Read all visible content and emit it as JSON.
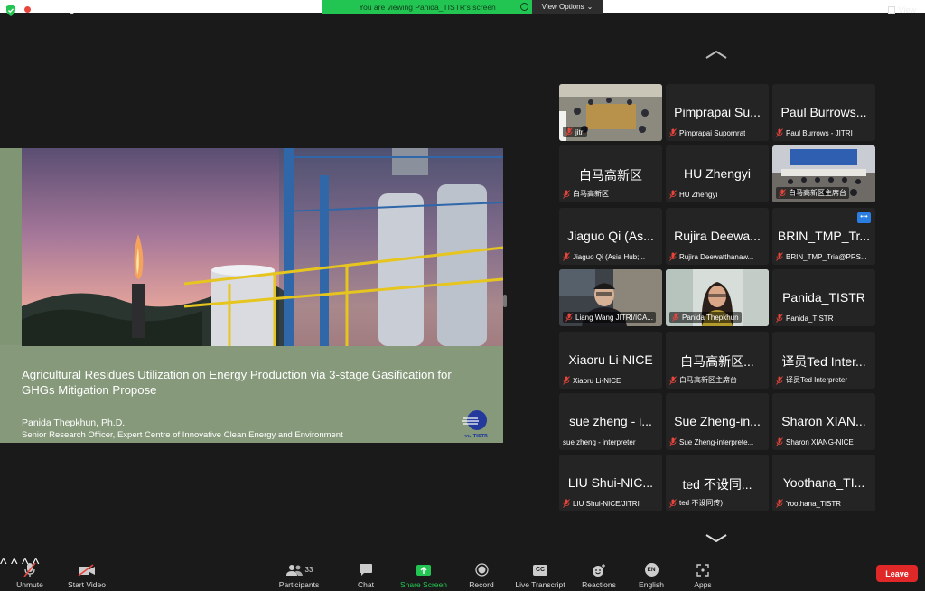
{
  "status": {
    "recording_label": "Recording"
  },
  "banner": {
    "text": "You are viewing Panida_TISTR's screen",
    "view_options": "View Options"
  },
  "view_button": "View",
  "slide": {
    "title": "Agricultural Residues Utilization on Energy Production via 3-stage Gasification for GHGs Mitigation Propose",
    "author": "Panida Thepkhun, Ph.D.",
    "role": "Senior Research Officer, Expert Centre of Innovative Clean Energy and Environment",
    "logo_text": "วว.-TISTR"
  },
  "participants": [
    {
      "big": "",
      "label": "jitri",
      "video": "room1"
    },
    {
      "big": "Pimprapai Su...",
      "label": "Pimprapai Supornrat"
    },
    {
      "big": "Paul Burrows...",
      "label": "Paul Burrows - JITRI"
    },
    {
      "big": "白马高新区",
      "label": "白马高新区"
    },
    {
      "big": "HU Zhengyi",
      "label": "HU Zhengyi"
    },
    {
      "big": "",
      "label": "白马高新区主席台",
      "video": "room2"
    },
    {
      "big": "Jiaguo Qi (As...",
      "label": "Jiaguo Qi (Asia Hub;..."
    },
    {
      "big": "Rujira Deewa...",
      "label": "Rujira Deewatthanaw..."
    },
    {
      "big": "BRIN_TMP_Tr...",
      "label": "BRIN_TMP_Tria@PRS...",
      "more": true
    },
    {
      "big": "",
      "label": "Liang Wang JITRI/ICA...",
      "video": "man"
    },
    {
      "big": "",
      "label": "Panida Thepkhun",
      "video": "woman",
      "active": true
    },
    {
      "big": "Panida_TISTR",
      "label": "Panida_TISTR"
    },
    {
      "big": "Xiaoru Li-NICE",
      "label": "Xiaoru Li-NICE"
    },
    {
      "big": "白马高新区...",
      "label": "白马高新区主席台"
    },
    {
      "big": "译员Ted Inter...",
      "label": "译员Ted Interpreter"
    },
    {
      "big": "sue zheng - i...",
      "label": "sue zheng - interpreter",
      "nomic": true
    },
    {
      "big": "Sue Zheng-in...",
      "label": "Sue Zheng-interprete..."
    },
    {
      "big": "Sharon XIAN...",
      "label": "Sharon XIANG-NICE"
    },
    {
      "big": "LIU Shui-NIC...",
      "label": "LIU Shui-NICE/JITRI"
    },
    {
      "big": "ted 不设同...",
      "label": "ted 不设同传)"
    },
    {
      "big": "Yoothana_TI...",
      "label": "Yoothana_TISTR"
    }
  ],
  "toolbar": {
    "unmute": "Unmute",
    "start_video": "Start Video",
    "participants": "Participants",
    "participants_count": "33",
    "chat": "Chat",
    "share_screen": "Share Screen",
    "record": "Record",
    "live_transcript": "Live Transcript",
    "reactions": "Reactions",
    "english": "English",
    "english_badge": "EN",
    "apps": "Apps",
    "leave": "Leave",
    "cc_badge": "CC"
  },
  "colors": {
    "accent_green": "#23c552",
    "leave_red": "#e02828",
    "mic_muted": "#e8453c"
  }
}
